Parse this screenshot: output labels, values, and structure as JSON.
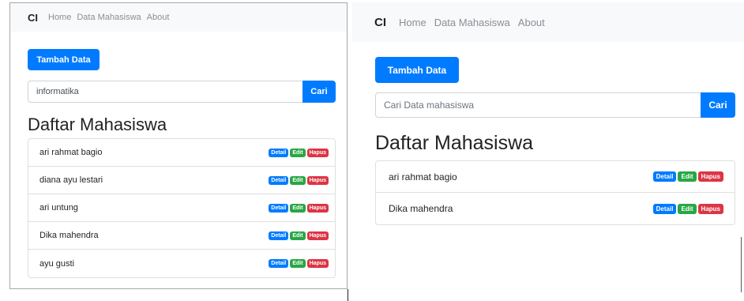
{
  "left": {
    "navbar": {
      "brand": "CI",
      "links": [
        "Home",
        "Data Mahasiswa",
        "About"
      ]
    },
    "add_button": "Tambah Data",
    "search": {
      "value": "informatika",
      "placeholder": "Cari Data mahasiswa",
      "button": "Cari"
    },
    "heading": "Daftar Mahasiswa",
    "students": [
      "ari rahmat bagio",
      "diana ayu lestari",
      "ari untung",
      "Dika mahendra",
      "ayu gusti"
    ],
    "actions": {
      "detail": "Detail",
      "edit": "Edit",
      "delete": "Hapus"
    }
  },
  "right": {
    "navbar": {
      "brand": "CI",
      "links": [
        "Home",
        "Data Mahasiswa",
        "About"
      ]
    },
    "add_button": "Tambah Data",
    "search": {
      "value": "",
      "placeholder": "Cari Data mahasiswa",
      "button": "Cari"
    },
    "heading": "Daftar Mahasiswa",
    "students": [
      "ari rahmat bagio",
      "Dika mahendra"
    ],
    "actions": {
      "detail": "Detail",
      "edit": "Edit",
      "delete": "Hapus"
    }
  },
  "colors": {
    "primary": "#007bff",
    "success": "#28a745",
    "danger": "#dc3545",
    "navbar_bg": "#f8f9fa"
  }
}
